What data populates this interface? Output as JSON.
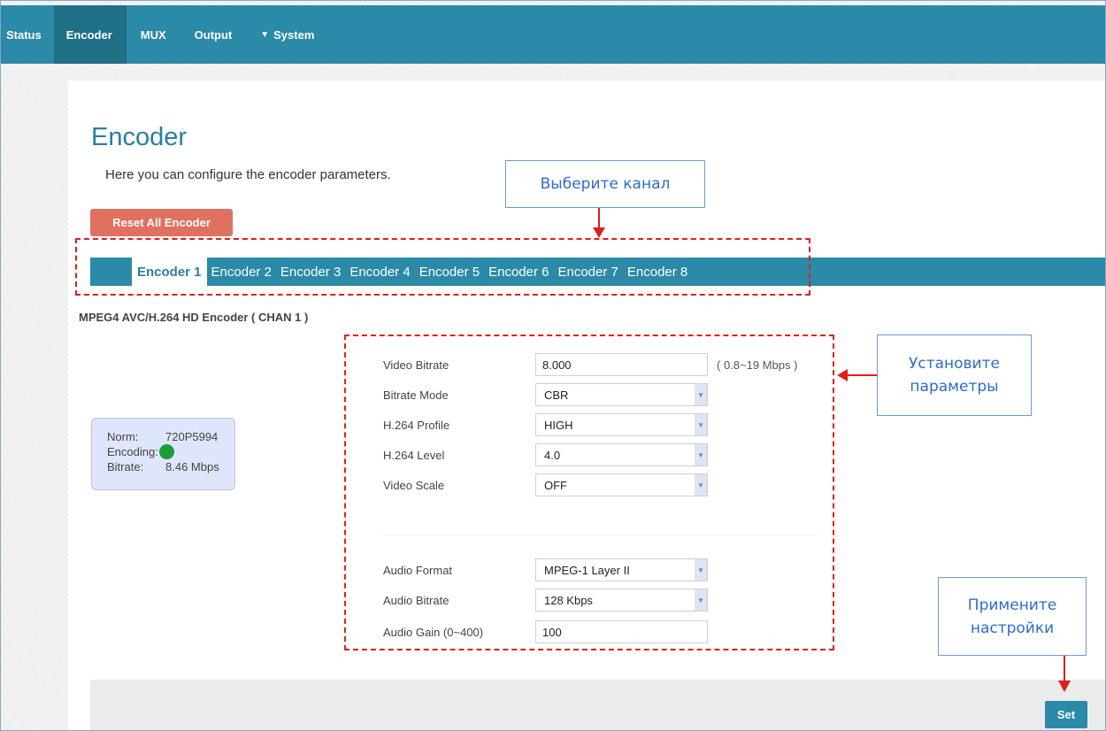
{
  "nav": {
    "items": [
      "Status",
      "Encoder",
      "MUX",
      "Output",
      "System"
    ],
    "active": "Encoder"
  },
  "page": {
    "title": "Encoder",
    "description": "Here you can configure the encoder parameters.",
    "reset_label": "Reset All Encoder",
    "channel_title": "MPEG4 AVC/H.264 HD Encoder ( CHAN 1 )"
  },
  "tabs": [
    "Encoder 1",
    "Encoder 2",
    "Encoder 3",
    "Encoder 4",
    "Encoder 5",
    "Encoder 6",
    "Encoder 7",
    "Encoder 8"
  ],
  "status": {
    "norm_label": "Norm:",
    "norm_value": "720P5994",
    "encoding_label": "Encoding:",
    "encoding_color": "#1a9b3c",
    "bitrate_label": "Bitrate:",
    "bitrate_value": "8.46 Mbps"
  },
  "form": {
    "video_bitrate": {
      "label": "Video Bitrate",
      "value": "8.000",
      "note": "( 0.8~19 Mbps )"
    },
    "bitrate_mode": {
      "label": "Bitrate Mode",
      "value": "CBR"
    },
    "h264_profile": {
      "label": "H.264 Profile",
      "value": "HIGH"
    },
    "h264_level": {
      "label": "H.264 Level",
      "value": "4.0"
    },
    "video_scale": {
      "label": "Video Scale",
      "value": "OFF"
    },
    "audio_format": {
      "label": "Audio Format",
      "value": "MPEG-1 Layer II"
    },
    "audio_bitrate": {
      "label": "Audio Bitrate",
      "value": "128 Kbps"
    },
    "audio_gain": {
      "label": "Audio Gain (0~400)",
      "value": "100"
    }
  },
  "set_label": "Set",
  "annotations": {
    "select_channel": "Выберите канал",
    "set_params_1": "Установите",
    "set_params_2": "параметры",
    "apply_1": "Примените",
    "apply_2": "настройки",
    "annotation_color": "#e01e1e",
    "callout_text_color": "#2f6cc7"
  },
  "colors": {
    "nav_bg": "#2a8aa7",
    "title": "#2a7fa0",
    "reset_btn": "#e0705f"
  }
}
